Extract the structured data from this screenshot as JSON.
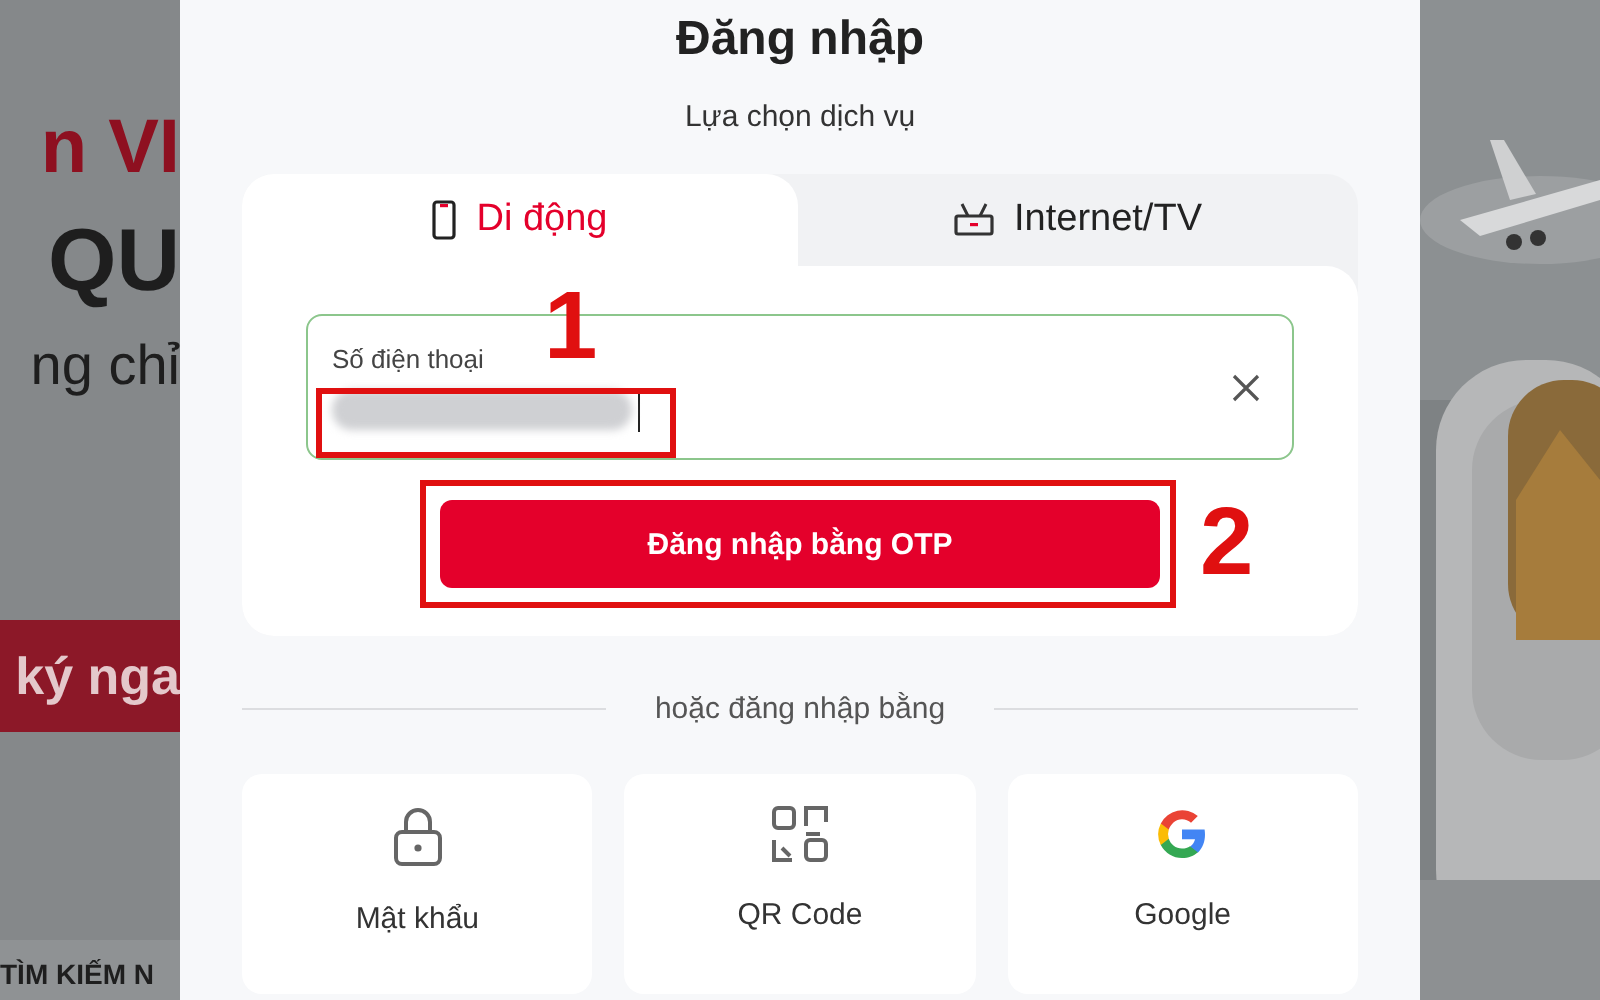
{
  "background_page": {
    "texts": [
      {
        "text": "n VI",
        "kind": "accent"
      },
      {
        "text": "QU",
        "kind": "heading"
      },
      {
        "text": "ng chỉ",
        "kind": "body"
      },
      {
        "text": "ký nga",
        "kind": "banner"
      },
      {
        "text": "TÌM KIẾM N",
        "kind": "strip"
      }
    ]
  },
  "modal": {
    "title": "Đăng nhập",
    "subtitle": "Lựa chọn dịch vụ",
    "tabs": [
      {
        "label": "Di động",
        "kind": "phone",
        "selected": true
      },
      {
        "label": "Internet/TV",
        "kind": "router",
        "selected": false
      }
    ],
    "phone_field": {
      "label": "Số điện thoại",
      "value_blurred": true,
      "annotation": "1"
    },
    "submit_button": {
      "label": "Đăng nhập bằng OTP",
      "annotation": "2"
    },
    "divider_text": "hoặc đăng nhập bằng",
    "options": [
      {
        "label": "Mật khẩu",
        "kind": "password"
      },
      {
        "label": "QR Code",
        "kind": "qr"
      },
      {
        "label": "Google",
        "kind": "google"
      }
    ]
  }
}
